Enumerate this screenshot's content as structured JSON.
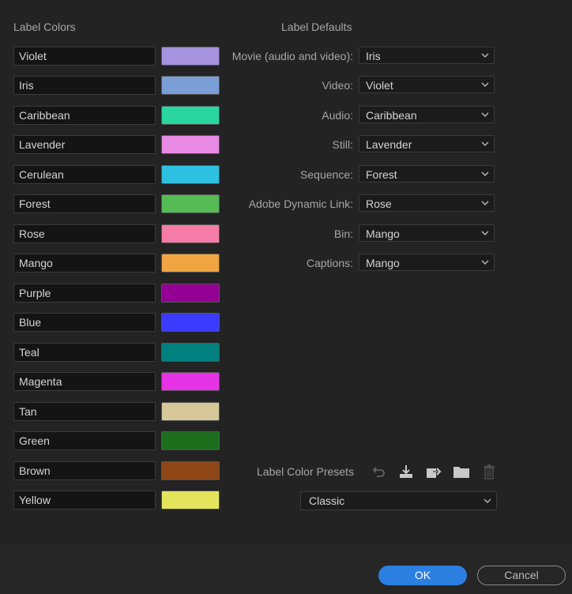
{
  "headings": {
    "label_colors": "Label Colors",
    "label_defaults": "Label Defaults",
    "presets": "Label Color Presets"
  },
  "labels": [
    {
      "name": "Violet",
      "color": "#a593e0"
    },
    {
      "name": "Iris",
      "color": "#7a9fd6"
    },
    {
      "name": "Caribbean",
      "color": "#2ad6a0"
    },
    {
      "name": "Lavender",
      "color": "#e889e3"
    },
    {
      "name": "Cerulean",
      "color": "#2dc0e0"
    },
    {
      "name": "Forest",
      "color": "#55bb55"
    },
    {
      "name": "Rose",
      "color": "#f57ca6"
    },
    {
      "name": "Mango",
      "color": "#f0a542"
    },
    {
      "name": "Purple",
      "color": "#930093"
    },
    {
      "name": "Blue",
      "color": "#3b3bff"
    },
    {
      "name": "Teal",
      "color": "#018080"
    },
    {
      "name": "Magenta",
      "color": "#e633e6"
    },
    {
      "name": "Tan",
      "color": "#d6c898"
    },
    {
      "name": "Green",
      "color": "#1c6e1c"
    },
    {
      "name": "Brown",
      "color": "#8e4616"
    },
    {
      "name": "Yellow",
      "color": "#e4e45c"
    }
  ],
  "defaults": [
    {
      "label": "Movie (audio and video):",
      "value": "Iris"
    },
    {
      "label": "Video:",
      "value": "Violet"
    },
    {
      "label": "Audio:",
      "value": "Caribbean"
    },
    {
      "label": "Still:",
      "value": "Lavender"
    },
    {
      "label": "Sequence:",
      "value": "Forest"
    },
    {
      "label": "Adobe Dynamic Link:",
      "value": "Rose"
    },
    {
      "label": "Bin:",
      "value": "Mango"
    },
    {
      "label": "Captions:",
      "value": "Mango"
    }
  ],
  "preset": {
    "selected": "Classic"
  },
  "preset_icons": [
    "undo-icon",
    "import-icon",
    "export-icon",
    "folder-icon",
    "trash-icon"
  ],
  "buttons": {
    "ok": "OK",
    "cancel": "Cancel"
  },
  "colors": {
    "accent": "#2b7fe0",
    "background": "#232323"
  }
}
